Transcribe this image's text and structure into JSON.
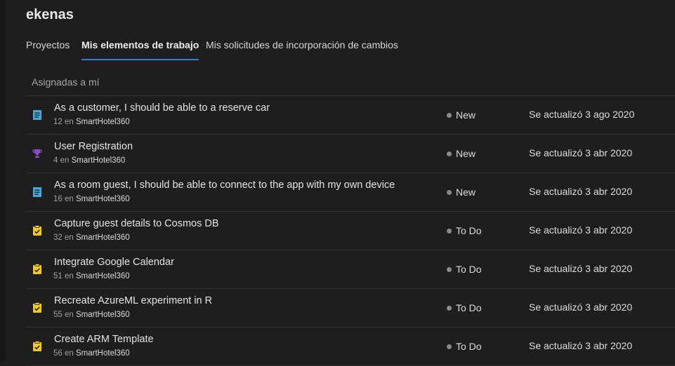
{
  "header": {
    "title": "ekenas"
  },
  "tabs": [
    {
      "label": "Proyectos",
      "active": false
    },
    {
      "label": "Mis elementos de trabajo",
      "active": true
    },
    {
      "label": "Mis solicitudes de incorporación de cambios",
      "active": false
    }
  ],
  "colors": {
    "accent": "#2f7fd1",
    "story_icon": "#3fa9e0",
    "feature_icon": "#8a4cc7",
    "task_icon": "#f2cb1d",
    "state_dot": "#8a8a8a"
  },
  "group": {
    "label": "Asignadas a mí"
  },
  "items": [
    {
      "type": "user-story",
      "icon": "book-icon",
      "title": "As a customer, I should be able to a reserve car",
      "id": "12",
      "en": "en",
      "project": "SmartHotel360",
      "state": "New",
      "updated": "Se actualizó 3 ago 2020"
    },
    {
      "type": "feature",
      "icon": "trophy-icon",
      "title": "User Registration",
      "id": "4",
      "en": "en",
      "project": "SmartHotel360",
      "state": "New",
      "updated": "Se actualizó 3 abr 2020"
    },
    {
      "type": "user-story",
      "icon": "book-icon",
      "title": "As a room guest, I should be able to connect to the app with my own device",
      "id": "16",
      "en": "en",
      "project": "SmartHotel360",
      "state": "New",
      "updated": "Se actualizó 3 abr 2020"
    },
    {
      "type": "task",
      "icon": "clipboard-icon",
      "title": "Capture guest details to Cosmos DB",
      "id": "32",
      "en": "en",
      "project": "SmartHotel360",
      "state": "To Do",
      "updated": "Se actualizó 3 abr 2020"
    },
    {
      "type": "task",
      "icon": "clipboard-icon",
      "title": "Integrate Google Calendar",
      "id": "51",
      "en": "en",
      "project": "SmartHotel360",
      "state": "To Do",
      "updated": "Se actualizó 3 abr 2020"
    },
    {
      "type": "task",
      "icon": "clipboard-icon",
      "title": "Recreate AzureML experiment in R",
      "id": "55",
      "en": "en",
      "project": "SmartHotel360",
      "state": "To Do",
      "updated": "Se actualizó 3 abr 2020"
    },
    {
      "type": "task",
      "icon": "clipboard-icon",
      "title": "Create ARM Template",
      "id": "56",
      "en": "en",
      "project": "SmartHotel360",
      "state": "To Do",
      "updated": "Se actualizó 3 abr 2020"
    }
  ]
}
